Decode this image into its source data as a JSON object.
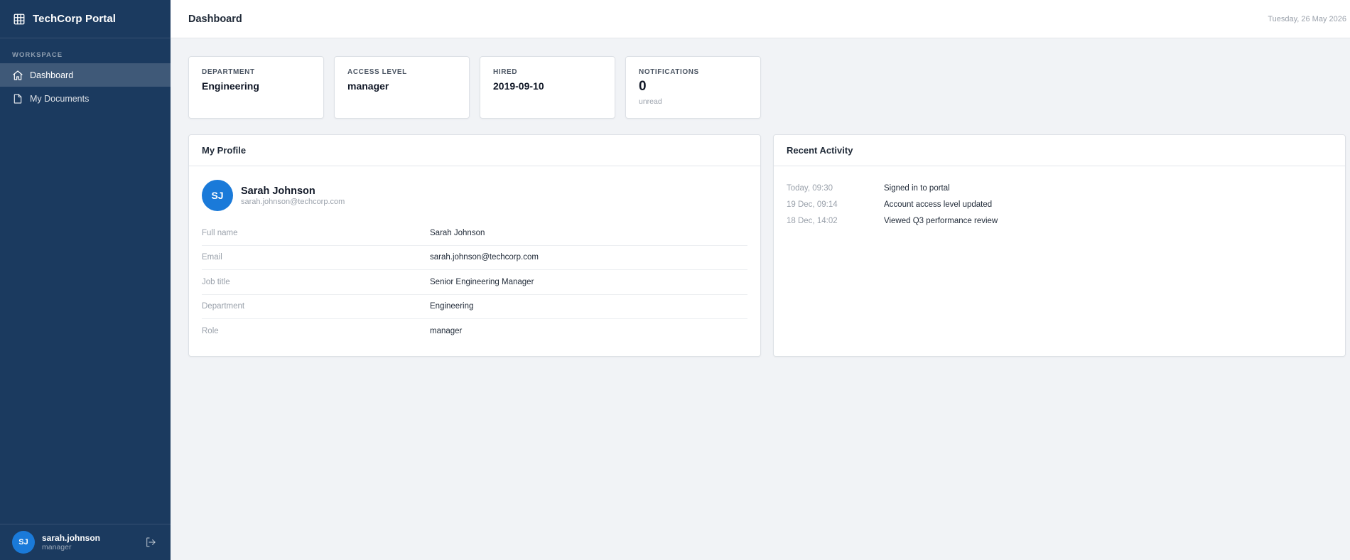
{
  "sidebar": {
    "brand_title": "TechCorp Portal",
    "brand_icon": "building-icon",
    "section_label": "WORKSPACE",
    "items": [
      {
        "label": "Dashboard",
        "icon": "home-icon",
        "active": true
      },
      {
        "label": "My Documents",
        "icon": "document-icon",
        "active": false
      }
    ],
    "user": {
      "initials": "SJ",
      "username": "sarah.johnson",
      "role": "manager",
      "logout_icon": "logout-icon"
    }
  },
  "header": {
    "title": "Dashboard",
    "date": "Tuesday, 26 May 2026"
  },
  "stats": [
    {
      "label": "DEPARTMENT",
      "value": "Engineering"
    },
    {
      "label": "ACCESS LEVEL",
      "value": "manager"
    },
    {
      "label": "HIRED",
      "value": "2019-09-10"
    },
    {
      "label": "NOTIFICATIONS",
      "value": "0",
      "sub": "unread"
    }
  ],
  "profile": {
    "title": "My Profile",
    "initials": "SJ",
    "name": "Sarah Johnson",
    "email": "sarah.johnson@techcorp.com",
    "fields": [
      {
        "label": "Full name",
        "value": "Sarah Johnson"
      },
      {
        "label": "Email",
        "value": "sarah.johnson@techcorp.com"
      },
      {
        "label": "Job title",
        "value": "Senior Engineering Manager"
      },
      {
        "label": "Department",
        "value": "Engineering"
      },
      {
        "label": "Role",
        "value": "manager"
      }
    ]
  },
  "activity": {
    "title": "Recent Activity",
    "items": [
      {
        "time": "Today, 09:30",
        "text": "Signed in to portal"
      },
      {
        "time": "19 Dec, 09:14",
        "text": "Account access level updated"
      },
      {
        "time": "18 Dec, 14:02",
        "text": "Viewed Q3 performance review"
      }
    ]
  },
  "colors": {
    "sidebar_bg": "#1b3a5f",
    "accent": "#1a7ad9",
    "page_bg": "#f1f3f6"
  }
}
